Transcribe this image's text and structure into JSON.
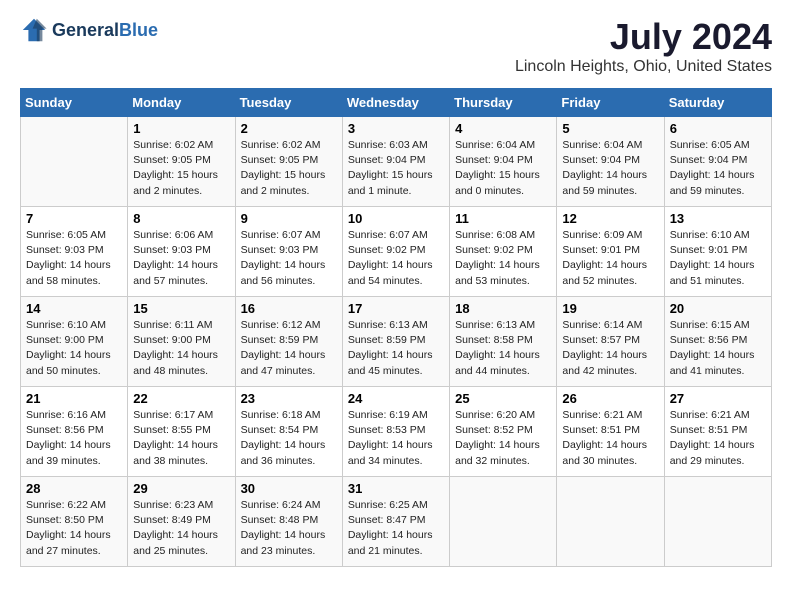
{
  "header": {
    "logo_general": "General",
    "logo_blue": "Blue",
    "month": "July 2024",
    "location": "Lincoln Heights, Ohio, United States"
  },
  "days_of_week": [
    "Sunday",
    "Monday",
    "Tuesday",
    "Wednesday",
    "Thursday",
    "Friday",
    "Saturday"
  ],
  "weeks": [
    [
      {
        "day": "",
        "info": ""
      },
      {
        "day": "1",
        "info": "Sunrise: 6:02 AM\nSunset: 9:05 PM\nDaylight: 15 hours\nand 2 minutes."
      },
      {
        "day": "2",
        "info": "Sunrise: 6:02 AM\nSunset: 9:05 PM\nDaylight: 15 hours\nand 2 minutes."
      },
      {
        "day": "3",
        "info": "Sunrise: 6:03 AM\nSunset: 9:04 PM\nDaylight: 15 hours\nand 1 minute."
      },
      {
        "day": "4",
        "info": "Sunrise: 6:04 AM\nSunset: 9:04 PM\nDaylight: 15 hours\nand 0 minutes."
      },
      {
        "day": "5",
        "info": "Sunrise: 6:04 AM\nSunset: 9:04 PM\nDaylight: 14 hours\nand 59 minutes."
      },
      {
        "day": "6",
        "info": "Sunrise: 6:05 AM\nSunset: 9:04 PM\nDaylight: 14 hours\nand 59 minutes."
      }
    ],
    [
      {
        "day": "7",
        "info": "Sunrise: 6:05 AM\nSunset: 9:03 PM\nDaylight: 14 hours\nand 58 minutes."
      },
      {
        "day": "8",
        "info": "Sunrise: 6:06 AM\nSunset: 9:03 PM\nDaylight: 14 hours\nand 57 minutes."
      },
      {
        "day": "9",
        "info": "Sunrise: 6:07 AM\nSunset: 9:03 PM\nDaylight: 14 hours\nand 56 minutes."
      },
      {
        "day": "10",
        "info": "Sunrise: 6:07 AM\nSunset: 9:02 PM\nDaylight: 14 hours\nand 54 minutes."
      },
      {
        "day": "11",
        "info": "Sunrise: 6:08 AM\nSunset: 9:02 PM\nDaylight: 14 hours\nand 53 minutes."
      },
      {
        "day": "12",
        "info": "Sunrise: 6:09 AM\nSunset: 9:01 PM\nDaylight: 14 hours\nand 52 minutes."
      },
      {
        "day": "13",
        "info": "Sunrise: 6:10 AM\nSunset: 9:01 PM\nDaylight: 14 hours\nand 51 minutes."
      }
    ],
    [
      {
        "day": "14",
        "info": "Sunrise: 6:10 AM\nSunset: 9:00 PM\nDaylight: 14 hours\nand 50 minutes."
      },
      {
        "day": "15",
        "info": "Sunrise: 6:11 AM\nSunset: 9:00 PM\nDaylight: 14 hours\nand 48 minutes."
      },
      {
        "day": "16",
        "info": "Sunrise: 6:12 AM\nSunset: 8:59 PM\nDaylight: 14 hours\nand 47 minutes."
      },
      {
        "day": "17",
        "info": "Sunrise: 6:13 AM\nSunset: 8:59 PM\nDaylight: 14 hours\nand 45 minutes."
      },
      {
        "day": "18",
        "info": "Sunrise: 6:13 AM\nSunset: 8:58 PM\nDaylight: 14 hours\nand 44 minutes."
      },
      {
        "day": "19",
        "info": "Sunrise: 6:14 AM\nSunset: 8:57 PM\nDaylight: 14 hours\nand 42 minutes."
      },
      {
        "day": "20",
        "info": "Sunrise: 6:15 AM\nSunset: 8:56 PM\nDaylight: 14 hours\nand 41 minutes."
      }
    ],
    [
      {
        "day": "21",
        "info": "Sunrise: 6:16 AM\nSunset: 8:56 PM\nDaylight: 14 hours\nand 39 minutes."
      },
      {
        "day": "22",
        "info": "Sunrise: 6:17 AM\nSunset: 8:55 PM\nDaylight: 14 hours\nand 38 minutes."
      },
      {
        "day": "23",
        "info": "Sunrise: 6:18 AM\nSunset: 8:54 PM\nDaylight: 14 hours\nand 36 minutes."
      },
      {
        "day": "24",
        "info": "Sunrise: 6:19 AM\nSunset: 8:53 PM\nDaylight: 14 hours\nand 34 minutes."
      },
      {
        "day": "25",
        "info": "Sunrise: 6:20 AM\nSunset: 8:52 PM\nDaylight: 14 hours\nand 32 minutes."
      },
      {
        "day": "26",
        "info": "Sunrise: 6:21 AM\nSunset: 8:51 PM\nDaylight: 14 hours\nand 30 minutes."
      },
      {
        "day": "27",
        "info": "Sunrise: 6:21 AM\nSunset: 8:51 PM\nDaylight: 14 hours\nand 29 minutes."
      }
    ],
    [
      {
        "day": "28",
        "info": "Sunrise: 6:22 AM\nSunset: 8:50 PM\nDaylight: 14 hours\nand 27 minutes."
      },
      {
        "day": "29",
        "info": "Sunrise: 6:23 AM\nSunset: 8:49 PM\nDaylight: 14 hours\nand 25 minutes."
      },
      {
        "day": "30",
        "info": "Sunrise: 6:24 AM\nSunset: 8:48 PM\nDaylight: 14 hours\nand 23 minutes."
      },
      {
        "day": "31",
        "info": "Sunrise: 6:25 AM\nSunset: 8:47 PM\nDaylight: 14 hours\nand 21 minutes."
      },
      {
        "day": "",
        "info": ""
      },
      {
        "day": "",
        "info": ""
      },
      {
        "day": "",
        "info": ""
      }
    ]
  ]
}
